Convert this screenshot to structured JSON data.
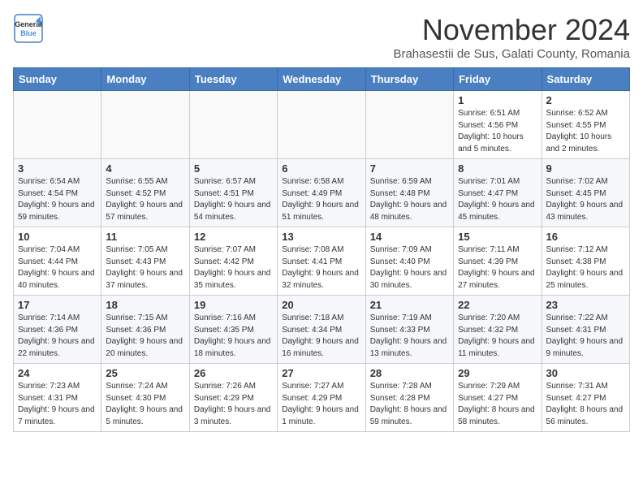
{
  "header": {
    "logo_line1": "General",
    "logo_line2": "Blue",
    "title": "November 2024",
    "subtitle": "Brahasestii de Sus, Galati County, Romania"
  },
  "weekdays": [
    "Sunday",
    "Monday",
    "Tuesday",
    "Wednesday",
    "Thursday",
    "Friday",
    "Saturday"
  ],
  "weeks": [
    [
      {
        "day": "",
        "info": ""
      },
      {
        "day": "",
        "info": ""
      },
      {
        "day": "",
        "info": ""
      },
      {
        "day": "",
        "info": ""
      },
      {
        "day": "",
        "info": ""
      },
      {
        "day": "1",
        "info": "Sunrise: 6:51 AM\nSunset: 4:56 PM\nDaylight: 10 hours and 5 minutes."
      },
      {
        "day": "2",
        "info": "Sunrise: 6:52 AM\nSunset: 4:55 PM\nDaylight: 10 hours and 2 minutes."
      }
    ],
    [
      {
        "day": "3",
        "info": "Sunrise: 6:54 AM\nSunset: 4:54 PM\nDaylight: 9 hours and 59 minutes."
      },
      {
        "day": "4",
        "info": "Sunrise: 6:55 AM\nSunset: 4:52 PM\nDaylight: 9 hours and 57 minutes."
      },
      {
        "day": "5",
        "info": "Sunrise: 6:57 AM\nSunset: 4:51 PM\nDaylight: 9 hours and 54 minutes."
      },
      {
        "day": "6",
        "info": "Sunrise: 6:58 AM\nSunset: 4:49 PM\nDaylight: 9 hours and 51 minutes."
      },
      {
        "day": "7",
        "info": "Sunrise: 6:59 AM\nSunset: 4:48 PM\nDaylight: 9 hours and 48 minutes."
      },
      {
        "day": "8",
        "info": "Sunrise: 7:01 AM\nSunset: 4:47 PM\nDaylight: 9 hours and 45 minutes."
      },
      {
        "day": "9",
        "info": "Sunrise: 7:02 AM\nSunset: 4:45 PM\nDaylight: 9 hours and 43 minutes."
      }
    ],
    [
      {
        "day": "10",
        "info": "Sunrise: 7:04 AM\nSunset: 4:44 PM\nDaylight: 9 hours and 40 minutes."
      },
      {
        "day": "11",
        "info": "Sunrise: 7:05 AM\nSunset: 4:43 PM\nDaylight: 9 hours and 37 minutes."
      },
      {
        "day": "12",
        "info": "Sunrise: 7:07 AM\nSunset: 4:42 PM\nDaylight: 9 hours and 35 minutes."
      },
      {
        "day": "13",
        "info": "Sunrise: 7:08 AM\nSunset: 4:41 PM\nDaylight: 9 hours and 32 minutes."
      },
      {
        "day": "14",
        "info": "Sunrise: 7:09 AM\nSunset: 4:40 PM\nDaylight: 9 hours and 30 minutes."
      },
      {
        "day": "15",
        "info": "Sunrise: 7:11 AM\nSunset: 4:39 PM\nDaylight: 9 hours and 27 minutes."
      },
      {
        "day": "16",
        "info": "Sunrise: 7:12 AM\nSunset: 4:38 PM\nDaylight: 9 hours and 25 minutes."
      }
    ],
    [
      {
        "day": "17",
        "info": "Sunrise: 7:14 AM\nSunset: 4:36 PM\nDaylight: 9 hours and 22 minutes."
      },
      {
        "day": "18",
        "info": "Sunrise: 7:15 AM\nSunset: 4:36 PM\nDaylight: 9 hours and 20 minutes."
      },
      {
        "day": "19",
        "info": "Sunrise: 7:16 AM\nSunset: 4:35 PM\nDaylight: 9 hours and 18 minutes."
      },
      {
        "day": "20",
        "info": "Sunrise: 7:18 AM\nSunset: 4:34 PM\nDaylight: 9 hours and 16 minutes."
      },
      {
        "day": "21",
        "info": "Sunrise: 7:19 AM\nSunset: 4:33 PM\nDaylight: 9 hours and 13 minutes."
      },
      {
        "day": "22",
        "info": "Sunrise: 7:20 AM\nSunset: 4:32 PM\nDaylight: 9 hours and 11 minutes."
      },
      {
        "day": "23",
        "info": "Sunrise: 7:22 AM\nSunset: 4:31 PM\nDaylight: 9 hours and 9 minutes."
      }
    ],
    [
      {
        "day": "24",
        "info": "Sunrise: 7:23 AM\nSunset: 4:31 PM\nDaylight: 9 hours and 7 minutes."
      },
      {
        "day": "25",
        "info": "Sunrise: 7:24 AM\nSunset: 4:30 PM\nDaylight: 9 hours and 5 minutes."
      },
      {
        "day": "26",
        "info": "Sunrise: 7:26 AM\nSunset: 4:29 PM\nDaylight: 9 hours and 3 minutes."
      },
      {
        "day": "27",
        "info": "Sunrise: 7:27 AM\nSunset: 4:29 PM\nDaylight: 9 hours and 1 minute."
      },
      {
        "day": "28",
        "info": "Sunrise: 7:28 AM\nSunset: 4:28 PM\nDaylight: 8 hours and 59 minutes."
      },
      {
        "day": "29",
        "info": "Sunrise: 7:29 AM\nSunset: 4:27 PM\nDaylight: 8 hours and 58 minutes."
      },
      {
        "day": "30",
        "info": "Sunrise: 7:31 AM\nSunset: 4:27 PM\nDaylight: 8 hours and 56 minutes."
      }
    ]
  ]
}
